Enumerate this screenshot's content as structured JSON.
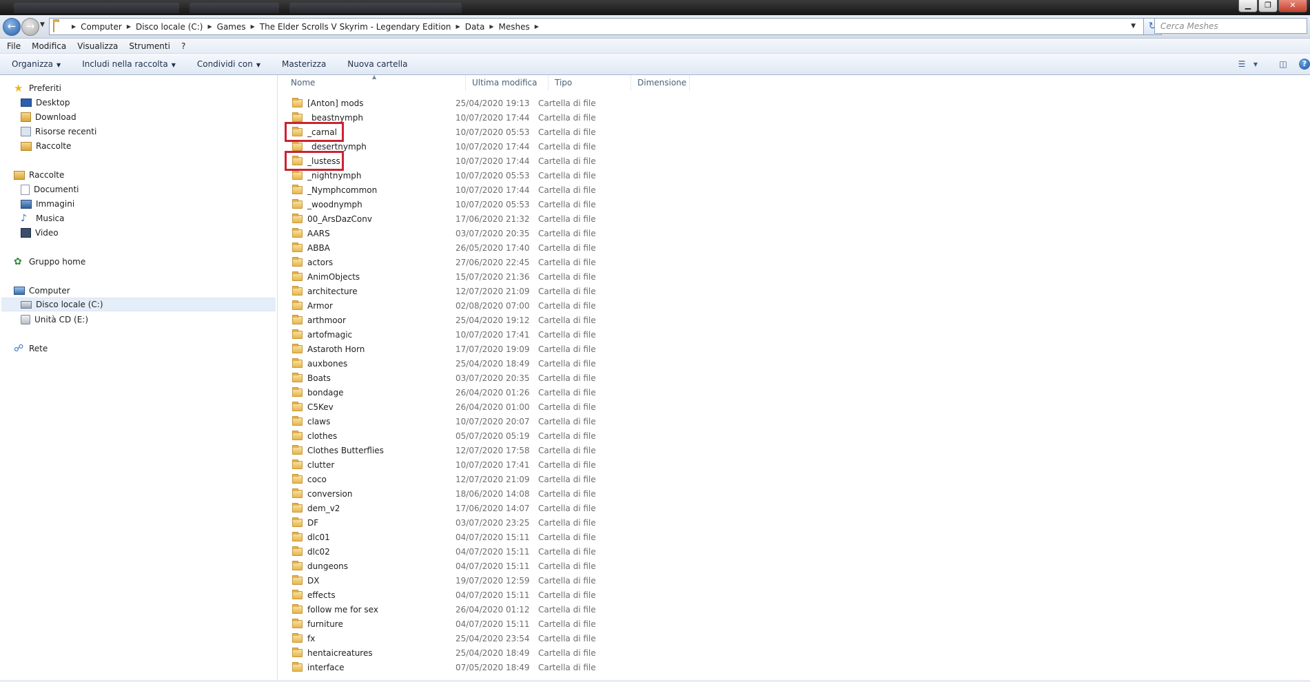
{
  "window": {
    "controls": {
      "minimize": "▁",
      "maximize": "❐",
      "close": "✕"
    }
  },
  "address": {
    "back_icon": "back-arrow-icon",
    "forward_icon": "forward-arrow-icon",
    "crumbs": [
      "Computer",
      "Disco locale (C:)",
      "Games",
      "The Elder Scrolls V Skyrim - Legendary Edition",
      "Data",
      "Meshes"
    ],
    "search_placeholder": "Cerca Meshes"
  },
  "menu": [
    "File",
    "Modifica",
    "Visualizza",
    "Strumenti",
    "?"
  ],
  "commands": {
    "organizza": "Organizza",
    "includi": "Includi nella raccolta",
    "condividi": "Condividi con",
    "masterizza": "Masterizza",
    "nuova_cartella": "Nuova cartella"
  },
  "nav": {
    "preferiti": "Preferiti",
    "desktop": "Desktop",
    "download": "Download",
    "risorse_recenti": "Risorse recenti",
    "raccolte_fav": "Raccolte",
    "raccolte": "Raccolte",
    "documenti": "Documenti",
    "immagini": "Immagini",
    "musica": "Musica",
    "video": "Video",
    "gruppo_home": "Gruppo home",
    "computer": "Computer",
    "disco_locale": "Disco locale (C:)",
    "unita_cd": "Unità CD (E:)",
    "rete": "Rete"
  },
  "columns": {
    "name": "Nome",
    "modified": "Ultima modifica",
    "type": "Tipo",
    "size": "Dimensione"
  },
  "files": [
    {
      "name": "[Anton] mods",
      "date": "25/04/2020 19:13",
      "type": "Cartella di file"
    },
    {
      "name": "_beastnymph",
      "date": "10/07/2020 17:44",
      "type": "Cartella di file"
    },
    {
      "name": "_carnal",
      "date": "10/07/2020 05:53",
      "type": "Cartella di file"
    },
    {
      "name": "_desertnymph",
      "date": "10/07/2020 17:44",
      "type": "Cartella di file"
    },
    {
      "name": "_lustess",
      "date": "10/07/2020 17:44",
      "type": "Cartella di file"
    },
    {
      "name": "_nightnymph",
      "date": "10/07/2020 05:53",
      "type": "Cartella di file"
    },
    {
      "name": "_Nymphcommon",
      "date": "10/07/2020 17:44",
      "type": "Cartella di file"
    },
    {
      "name": "_woodnymph",
      "date": "10/07/2020 05:53",
      "type": "Cartella di file"
    },
    {
      "name": "00_ArsDazConv",
      "date": "17/06/2020 21:32",
      "type": "Cartella di file"
    },
    {
      "name": "AARS",
      "date": "03/07/2020 20:35",
      "type": "Cartella di file"
    },
    {
      "name": "ABBA",
      "date": "26/05/2020 17:40",
      "type": "Cartella di file"
    },
    {
      "name": "actors",
      "date": "27/06/2020 22:45",
      "type": "Cartella di file"
    },
    {
      "name": "AnimObjects",
      "date": "15/07/2020 21:36",
      "type": "Cartella di file"
    },
    {
      "name": "architecture",
      "date": "12/07/2020 21:09",
      "type": "Cartella di file"
    },
    {
      "name": "Armor",
      "date": "02/08/2020 07:00",
      "type": "Cartella di file"
    },
    {
      "name": "arthmoor",
      "date": "25/04/2020 19:12",
      "type": "Cartella di file"
    },
    {
      "name": "artofmagic",
      "date": "10/07/2020 17:41",
      "type": "Cartella di file"
    },
    {
      "name": "Astaroth Horn",
      "date": "17/07/2020 19:09",
      "type": "Cartella di file"
    },
    {
      "name": "auxbones",
      "date": "25/04/2020 18:49",
      "type": "Cartella di file"
    },
    {
      "name": "Boats",
      "date": "03/07/2020 20:35",
      "type": "Cartella di file"
    },
    {
      "name": "bondage",
      "date": "26/04/2020 01:26",
      "type": "Cartella di file"
    },
    {
      "name": "C5Kev",
      "date": "26/04/2020 01:00",
      "type": "Cartella di file"
    },
    {
      "name": "claws",
      "date": "10/07/2020 20:07",
      "type": "Cartella di file"
    },
    {
      "name": "clothes",
      "date": "05/07/2020 05:19",
      "type": "Cartella di file"
    },
    {
      "name": "Clothes Butterflies",
      "date": "12/07/2020 17:58",
      "type": "Cartella di file"
    },
    {
      "name": "clutter",
      "date": "10/07/2020 17:41",
      "type": "Cartella di file"
    },
    {
      "name": "coco",
      "date": "12/07/2020 21:09",
      "type": "Cartella di file"
    },
    {
      "name": "conversion",
      "date": "18/06/2020 14:08",
      "type": "Cartella di file"
    },
    {
      "name": "dem_v2",
      "date": "17/06/2020 14:07",
      "type": "Cartella di file"
    },
    {
      "name": "DF",
      "date": "03/07/2020 23:25",
      "type": "Cartella di file"
    },
    {
      "name": "dlc01",
      "date": "04/07/2020 15:11",
      "type": "Cartella di file"
    },
    {
      "name": "dlc02",
      "date": "04/07/2020 15:11",
      "type": "Cartella di file"
    },
    {
      "name": "dungeons",
      "date": "04/07/2020 15:11",
      "type": "Cartella di file"
    },
    {
      "name": "DX",
      "date": "19/07/2020 12:59",
      "type": "Cartella di file"
    },
    {
      "name": "effects",
      "date": "04/07/2020 15:11",
      "type": "Cartella di file"
    },
    {
      "name": "follow me for sex",
      "date": "26/04/2020 01:12",
      "type": "Cartella di file"
    },
    {
      "name": "furniture",
      "date": "04/07/2020 15:11",
      "type": "Cartella di file"
    },
    {
      "name": "fx",
      "date": "25/04/2020 23:54",
      "type": "Cartella di file"
    },
    {
      "name": "hentaicreatures",
      "date": "25/04/2020 18:49",
      "type": "Cartella di file"
    },
    {
      "name": "interface",
      "date": "07/05/2020 18:49",
      "type": "Cartella di file"
    }
  ],
  "highlighted": [
    "_carnal",
    "_lustess"
  ],
  "colors": {
    "highlight_box": "#cc2233",
    "accent": "#2b5fa5"
  }
}
